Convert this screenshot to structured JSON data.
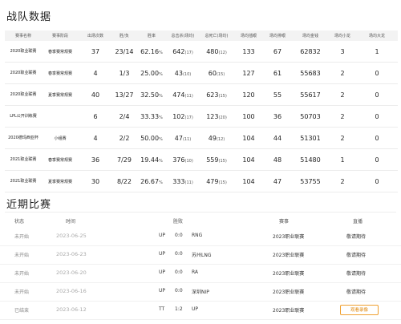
{
  "stats_section": {
    "title": "战队数据",
    "headers": [
      "赛事名称",
      "赛事阶段",
      "出场次数",
      "胜/负",
      "胜率",
      "总击杀(场均)",
      "总死亡(场均)",
      "场均插眼",
      "场均排眼",
      "场均金钱",
      "场均小龙",
      "场均大龙"
    ],
    "rows": [
      {
        "name": "2020职业联赛",
        "stage": "春季赛常规赛",
        "apps": "37",
        "wl": "23/14",
        "rate": "62.16",
        "kills": "642",
        "kavg": "17",
        "deaths": "480",
        "davg": "12",
        "wards": "133",
        "clear": "67",
        "gold": "62832",
        "dragon": "3",
        "baron": "1"
      },
      {
        "name": "2020职业联赛",
        "stage": "春季赛常规赛",
        "apps": "4",
        "wl": "1/3",
        "rate": "25.00",
        "kills": "43",
        "kavg": "10",
        "deaths": "60",
        "davg": "15",
        "wards": "127",
        "clear": "61",
        "gold": "55683",
        "dragon": "2",
        "baron": "0"
      },
      {
        "name": "2020职业联赛",
        "stage": "夏季赛常规赛",
        "apps": "40",
        "wl": "13/27",
        "rate": "32.50",
        "kills": "474",
        "kavg": "11",
        "deaths": "623",
        "davg": "15",
        "wards": "120",
        "clear": "55",
        "gold": "55617",
        "dragon": "2",
        "baron": "0"
      },
      {
        "name": "LPL公开训练赛",
        "stage": "",
        "apps": "6",
        "wl": "2/4",
        "rate": "33.33",
        "kills": "102",
        "kavg": "17",
        "deaths": "123",
        "davg": "20",
        "wards": "100",
        "clear": "36",
        "gold": "50703",
        "dragon": "2",
        "baron": "0"
      },
      {
        "name": "2020德玛西亚杯",
        "stage": "小组赛",
        "apps": "4",
        "wl": "2/2",
        "rate": "50.00",
        "kills": "47",
        "kavg": "11",
        "deaths": "49",
        "davg": "12",
        "wards": "104",
        "clear": "44",
        "gold": "51301",
        "dragon": "2",
        "baron": "0"
      },
      {
        "name": "2021职业联赛",
        "stage": "春季赛常规赛",
        "apps": "36",
        "wl": "7/29",
        "rate": "19.44",
        "kills": "376",
        "kavg": "10",
        "deaths": "559",
        "davg": "15",
        "wards": "104",
        "clear": "48",
        "gold": "51480",
        "dragon": "1",
        "baron": "0"
      },
      {
        "name": "2021职业联赛",
        "stage": "夏季赛常规赛",
        "apps": "30",
        "wl": "8/22",
        "rate": "26.67",
        "kills": "333",
        "kavg": "11",
        "deaths": "479",
        "davg": "15",
        "wards": "104",
        "clear": "47",
        "gold": "53755",
        "dragon": "2",
        "baron": "0"
      }
    ]
  },
  "recent_section": {
    "title": "近期比赛",
    "headers": {
      "status": "状态",
      "time": "时间",
      "result": "胜败",
      "league": "赛事",
      "live": "直播"
    },
    "rows": [
      {
        "status": "未开始",
        "time": "2023-06-25",
        "side": "UP",
        "score": "0:0",
        "opp": "RNG",
        "league": "2023职业联赛",
        "action": "敬请期待"
      },
      {
        "status": "未开始",
        "time": "2023-06-23",
        "side": "UP",
        "score": "0:0",
        "opp": "苏州LNG",
        "league": "2023职业联赛",
        "action": "敬请期待"
      },
      {
        "status": "未开始",
        "time": "2023-06-20",
        "side": "UP",
        "score": "0:0",
        "opp": "RA",
        "league": "2023职业联赛",
        "action": "敬请期待"
      },
      {
        "status": "未开始",
        "time": "2023-06-16",
        "side": "UP",
        "score": "0:0",
        "opp": "深圳NIP",
        "league": "2023职业联赛",
        "action": "敬请期待"
      },
      {
        "status": "已结束",
        "time": "2023-06-12",
        "side": "TT",
        "score": "1:2",
        "opp": "UP",
        "league": "2023职业联赛",
        "action": "观看录像"
      }
    ]
  },
  "colors": {
    "accent": "#f0a030",
    "header_bg": "#f3f3f3"
  }
}
